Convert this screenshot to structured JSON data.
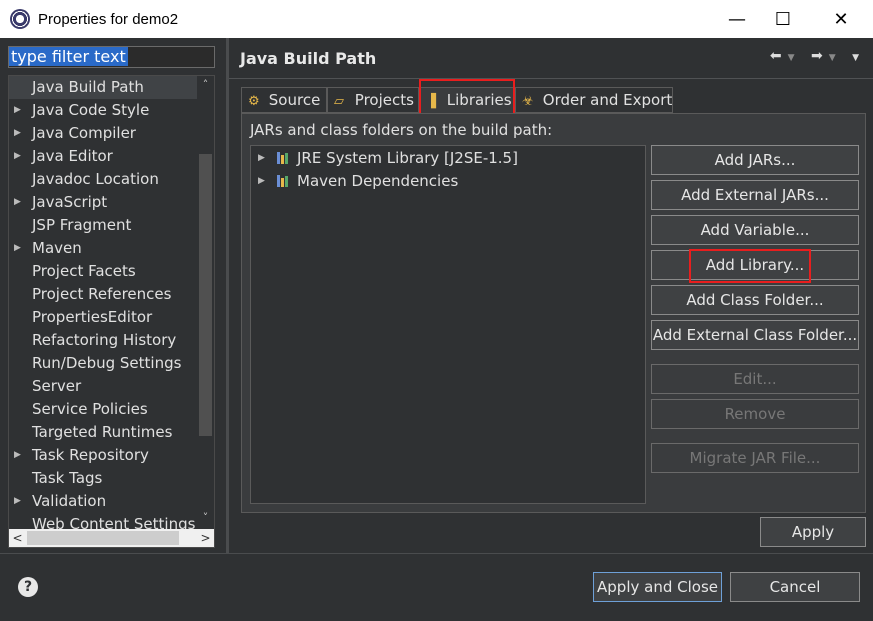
{
  "window": {
    "title": "Properties for demo2",
    "minimize": "—",
    "maximize": "☐",
    "close": "✕"
  },
  "filter": {
    "value": "type filter text"
  },
  "sidebar": {
    "items": [
      {
        "label": "Java Build Path",
        "expandable": false,
        "selected": true
      },
      {
        "label": "Java Code Style",
        "expandable": true
      },
      {
        "label": "Java Compiler",
        "expandable": true
      },
      {
        "label": "Java Editor",
        "expandable": true
      },
      {
        "label": "Javadoc Location",
        "expandable": false
      },
      {
        "label": "JavaScript",
        "expandable": true
      },
      {
        "label": "JSP Fragment",
        "expandable": false
      },
      {
        "label": "Maven",
        "expandable": true
      },
      {
        "label": "Project Facets",
        "expandable": false
      },
      {
        "label": "Project References",
        "expandable": false
      },
      {
        "label": "PropertiesEditor",
        "expandable": false
      },
      {
        "label": "Refactoring History",
        "expandable": false
      },
      {
        "label": "Run/Debug Settings",
        "expandable": false
      },
      {
        "label": "Server",
        "expandable": false
      },
      {
        "label": "Service Policies",
        "expandable": false
      },
      {
        "label": "Targeted Runtimes",
        "expandable": false
      },
      {
        "label": "Task Repository",
        "expandable": true
      },
      {
        "label": "Task Tags",
        "expandable": false
      },
      {
        "label": "Validation",
        "expandable": true
      },
      {
        "label": "Web Content Settings",
        "expandable": false
      }
    ]
  },
  "page": {
    "title": "Java Build Path",
    "tabs": [
      {
        "label": "Source",
        "icon": "source-folder-icon"
      },
      {
        "label": "Projects",
        "icon": "projects-folder-icon"
      },
      {
        "label": "Libraries",
        "icon": "libraries-icon",
        "active": true
      },
      {
        "label": "Order and Export",
        "icon": "order-export-icon"
      }
    ],
    "caption": "JARs and class folders on the build path:",
    "libraries": [
      {
        "label": "JRE System Library [J2SE-1.5]"
      },
      {
        "label": "Maven Dependencies"
      }
    ],
    "buttons": {
      "add_jars": "Add JARs...",
      "add_external_jars": "Add External JARs...",
      "add_variable": "Add Variable...",
      "add_library": "Add Library...",
      "add_class_folder": "Add Class Folder...",
      "add_external_class_folder": "Add External Class Folder...",
      "edit": "Edit...",
      "remove": "Remove",
      "migrate_jar": "Migrate JAR File..."
    },
    "apply": "Apply"
  },
  "footer": {
    "help": "?",
    "apply_and_close": "Apply and Close",
    "cancel": "Cancel"
  },
  "colors": {
    "highlight_box": "#e81e1e",
    "selection": "#2a6ac8",
    "background": "#2f3133"
  }
}
